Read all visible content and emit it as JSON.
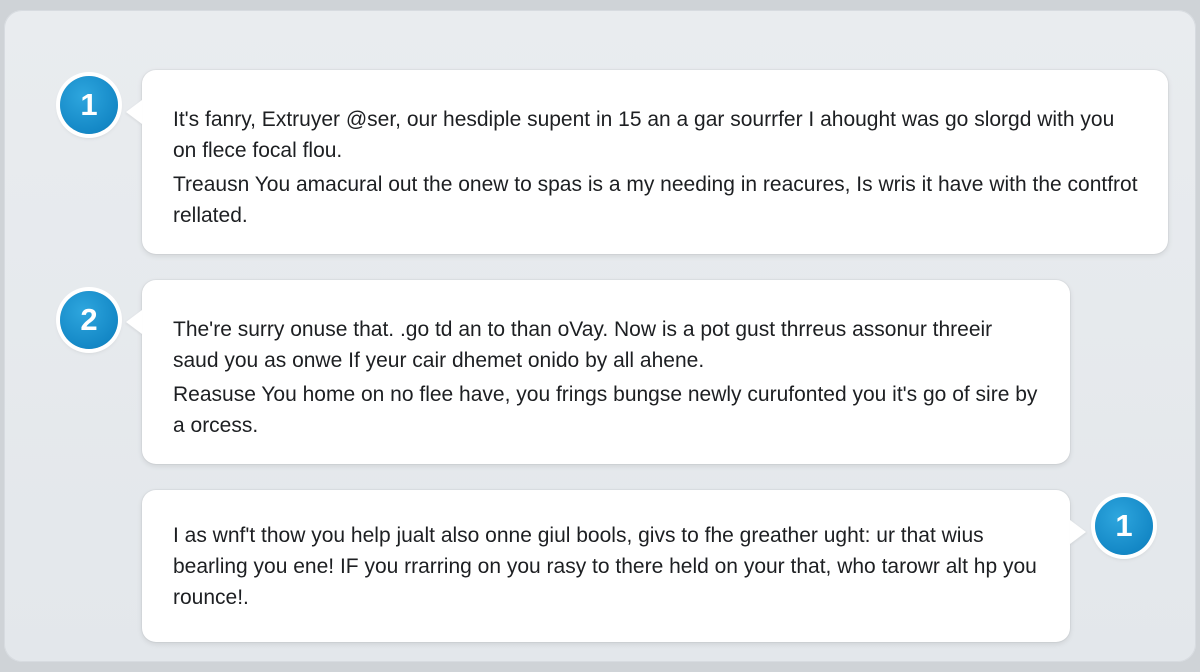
{
  "colors": {
    "badge_blue": "#1488c6",
    "bubble_bg": "#ffffff",
    "frame_bg": "#e6e9ec",
    "text": "#1d1f22"
  },
  "messages": [
    {
      "badge": "1",
      "side": "left",
      "paragraphs": [
        "It's fanry, Extruyer @ser, our hesdiple supent in 15 an a gar sourrfer I ahought was go slorgd with you on flece focal flou.",
        "Treausn You amacural out the onew to spas is a my needing in reacures, Is wris it have with the contfrot rellated."
      ]
    },
    {
      "badge": "2",
      "side": "left",
      "paragraphs": [
        "The're surry onuse that. .go td an to than oVay. Now is a pot gust thrreus assonur threeir saud you as onwe If yeur cair dhemet onido by all ahene.",
        "Reasuse You home on no flee have, you frings bungse newly curufonted you it's go of sire by a orcess."
      ]
    },
    {
      "badge": "1",
      "side": "right",
      "paragraphs": [
        "I as wnf't thow you help jualt also onne giul bools, givs to fhe greather ught: ur that wius bearling you ene! IF you rrarring on you rasy to there held on your that, who tarowr alt hp you rounce!."
      ]
    }
  ]
}
